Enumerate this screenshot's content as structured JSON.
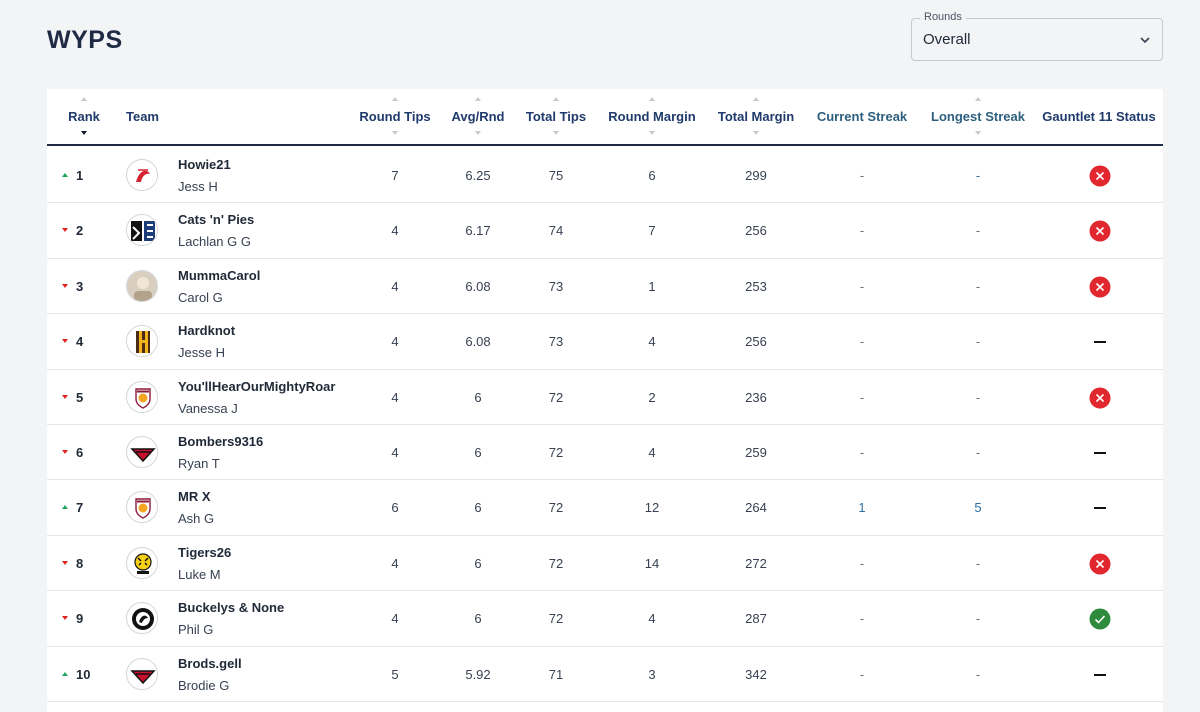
{
  "page_title": "WYPS",
  "rounds": {
    "label": "Rounds",
    "value": "Overall"
  },
  "columns": {
    "rank": "Rank",
    "team": "Team",
    "round_tips": "Round Tips",
    "avg_rnd": "Avg/Rnd",
    "total_tips": "Total Tips",
    "round_margin": "Round Margin",
    "total_margin": "Total Margin",
    "current_streak": "Current Streak",
    "longest_streak": "Longest Streak",
    "gauntlet": "Gauntlet 11 Status"
  },
  "colors": {
    "up": "#22a559",
    "down": "#e02424",
    "fail": "#e0282e",
    "pass": "#2e8b3e",
    "header": "#1f3a6b"
  },
  "rows": [
    {
      "rank": "1",
      "move": "up",
      "team": "Howie21",
      "owner": "Jess H",
      "round_tips": "7",
      "avg": "6.25",
      "total_tips": "75",
      "round_margin": "6",
      "total_margin": "299",
      "current_streak": "-",
      "longest_streak": "-",
      "status": "fail",
      "logo": "swans-logo"
    },
    {
      "rank": "2",
      "move": "down",
      "team": "Cats 'n' Pies",
      "owner": "Lachlan G G",
      "round_tips": "4",
      "avg": "6.17",
      "total_tips": "74",
      "round_margin": "7",
      "total_margin": "256",
      "current_streak": "-",
      "longest_streak": "-",
      "status": "fail",
      "logo": "cats-pies-logo"
    },
    {
      "rank": "3",
      "move": "down",
      "team": "MummaCarol",
      "owner": "Carol G",
      "round_tips": "4",
      "avg": "6.08",
      "total_tips": "73",
      "round_margin": "1",
      "total_margin": "253",
      "current_streak": "-",
      "longest_streak": "-",
      "status": "fail",
      "logo": "photo-avatar"
    },
    {
      "rank": "4",
      "move": "down",
      "team": "Hardknot",
      "owner": "Jesse H",
      "round_tips": "4",
      "avg": "6.08",
      "total_tips": "73",
      "round_margin": "4",
      "total_margin": "256",
      "current_streak": "-",
      "longest_streak": "-",
      "status": "none",
      "logo": "hawks-logo"
    },
    {
      "rank": "5",
      "move": "down",
      "team": "You'llHearOurMightyRoar",
      "owner": "Vanessa J",
      "round_tips": "4",
      "avg": "6",
      "total_tips": "72",
      "round_margin": "2",
      "total_margin": "236",
      "current_streak": "-",
      "longest_streak": "-",
      "status": "fail",
      "logo": "lions-logo"
    },
    {
      "rank": "6",
      "move": "down",
      "team": "Bombers9316",
      "owner": "Ryan T",
      "round_tips": "4",
      "avg": "6",
      "total_tips": "72",
      "round_margin": "4",
      "total_margin": "259",
      "current_streak": "-",
      "longest_streak": "-",
      "status": "none",
      "logo": "bombers-logo"
    },
    {
      "rank": "7",
      "move": "up",
      "team": "MR X",
      "owner": "Ash G",
      "round_tips": "6",
      "avg": "6",
      "total_tips": "72",
      "round_margin": "12",
      "total_margin": "264",
      "current_streak": "1",
      "longest_streak": "5",
      "status": "none",
      "logo": "lions-logo"
    },
    {
      "rank": "8",
      "move": "down",
      "team": "Tigers26",
      "owner": "Luke M",
      "round_tips": "4",
      "avg": "6",
      "total_tips": "72",
      "round_margin": "14",
      "total_margin": "272",
      "current_streak": "-",
      "longest_streak": "-",
      "status": "fail",
      "logo": "tigers-logo"
    },
    {
      "rank": "9",
      "move": "down",
      "team": "Buckelys & None",
      "owner": "Phil G",
      "round_tips": "4",
      "avg": "6",
      "total_tips": "72",
      "round_margin": "4",
      "total_margin": "287",
      "current_streak": "-",
      "longest_streak": "-",
      "status": "pass",
      "logo": "magpies-logo"
    },
    {
      "rank": "10",
      "move": "up",
      "team": "Brods.gell",
      "owner": "Brodie G",
      "round_tips": "5",
      "avg": "5.92",
      "total_tips": "71",
      "round_margin": "3",
      "total_margin": "342",
      "current_streak": "-",
      "longest_streak": "-",
      "status": "none",
      "logo": "bombers-logo"
    }
  ]
}
